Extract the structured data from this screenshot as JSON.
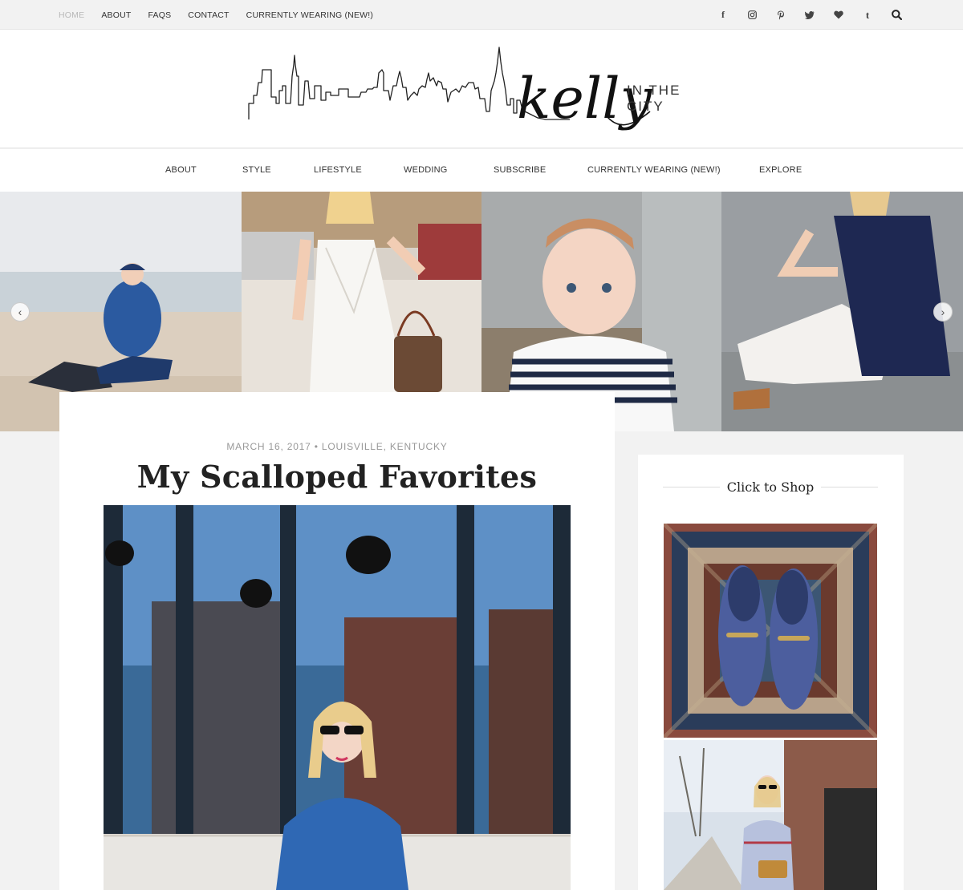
{
  "topnav": {
    "items": [
      "HOME",
      "ABOUT",
      "FAQS",
      "CONTACT",
      "CURRENTLY WEARING (NEW!)"
    ]
  },
  "social": {
    "facebook": "f",
    "tumblr": "t",
    "icons": [
      "facebook-icon",
      "instagram-icon",
      "pinterest-icon",
      "twitter-icon",
      "heart-icon",
      "tumblr-icon",
      "search-icon"
    ]
  },
  "logo": {
    "script": "kelly",
    "tagline": "IN THE CITY"
  },
  "mainnav": {
    "items": [
      "ABOUT",
      "STYLE",
      "LIFESTYLE",
      "WEDDING",
      "SUBSCRIBE",
      "CURRENTLY WEARING (NEW!)",
      "EXPLORE"
    ]
  },
  "slider": {
    "prev": "‹",
    "next": "›"
  },
  "post": {
    "meta": "MARCH 16, 2017 • LOUISVILLE, KENTUCKY",
    "title": "My Scalloped Favorites"
  },
  "sidebar": {
    "widget_title": "Click to Shop"
  },
  "colors": {
    "background": "#f2f2f2",
    "card": "#ffffff",
    "nav_text": "#333333",
    "muted": "#999999"
  }
}
